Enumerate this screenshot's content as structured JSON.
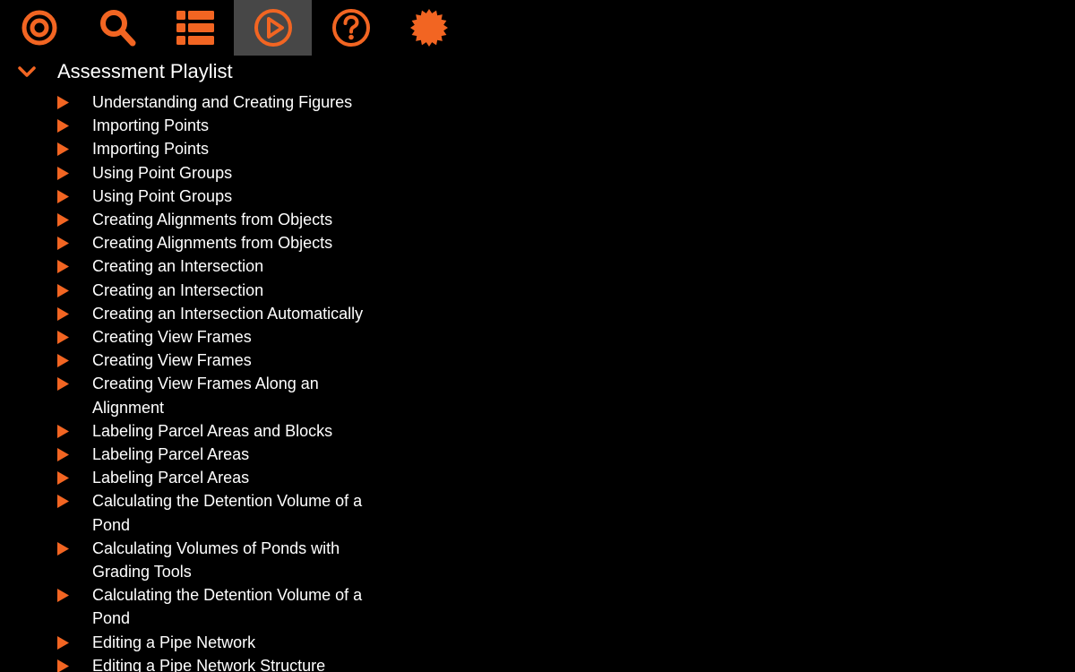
{
  "colors": {
    "accent": "#f26522",
    "background": "#000000",
    "active_tab": "#474747",
    "text": "#ffffff"
  },
  "toolbar": {
    "items": [
      {
        "icon": "target-icon",
        "active": false
      },
      {
        "icon": "search-icon",
        "active": false
      },
      {
        "icon": "list-icon",
        "active": false
      },
      {
        "icon": "play-circle-icon",
        "active": true
      },
      {
        "icon": "help-icon",
        "active": false
      },
      {
        "icon": "badge-icon",
        "active": false
      }
    ]
  },
  "playlist": {
    "title": "Assessment Playlist",
    "expanded": true,
    "items": [
      "Understanding and Creating Figures",
      "Importing Points",
      "Importing Points",
      "Using Point Groups",
      "Using Point Groups",
      "Creating Alignments from Objects",
      "Creating Alignments from Objects",
      "Creating an Intersection",
      "Creating an Intersection",
      "Creating an Intersection Automatically",
      "Creating View Frames",
      "Creating View Frames",
      "Creating View Frames Along an Alignment",
      "Labeling Parcel Areas and Blocks",
      "Labeling Parcel Areas",
      "Labeling Parcel Areas",
      "Calculating the Detention Volume of a Pond",
      "Calculating Volumes of Ponds with Grading Tools",
      "Calculating the Detention Volume of a Pond",
      "Editing a Pipe Network",
      "Editing a Pipe Network Structure"
    ]
  }
}
